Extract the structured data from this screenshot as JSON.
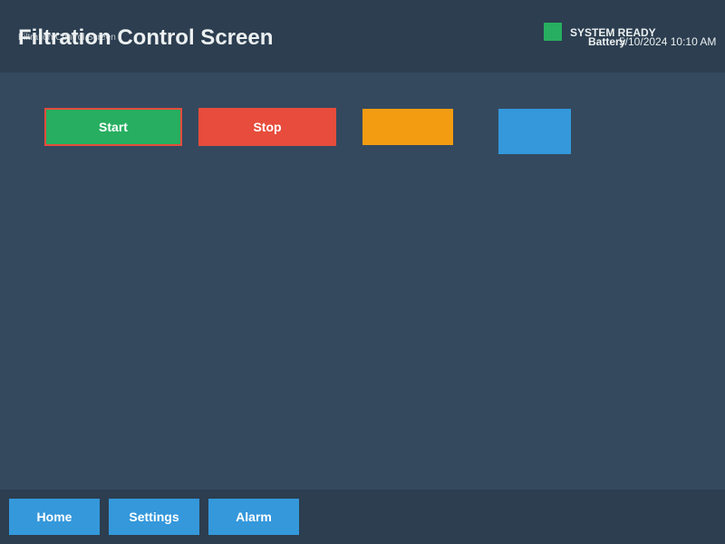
{
  "header": {
    "small_title": "Filtration Control Screen",
    "title": "Filtration Control Screen",
    "status": {
      "text": "SYSTEM READY",
      "color": "#27ae60"
    },
    "battery_label": "Battery",
    "datetime": "5/10/2024 10:10 AM"
  },
  "controls": {
    "start_label": "Start",
    "stop_label": "Stop",
    "colors": {
      "start": "#27ae60",
      "start_border": "#e74c3c",
      "stop": "#e74c3c",
      "orange": "#f39c12",
      "blue": "#3498db"
    }
  },
  "nav": {
    "items": [
      {
        "label": "Home"
      },
      {
        "label": "Settings"
      },
      {
        "label": "Alarm"
      }
    ]
  },
  "theme": {
    "background": "#34495e",
    "bar": "#2c3e50",
    "text": "#ecf0f1"
  }
}
